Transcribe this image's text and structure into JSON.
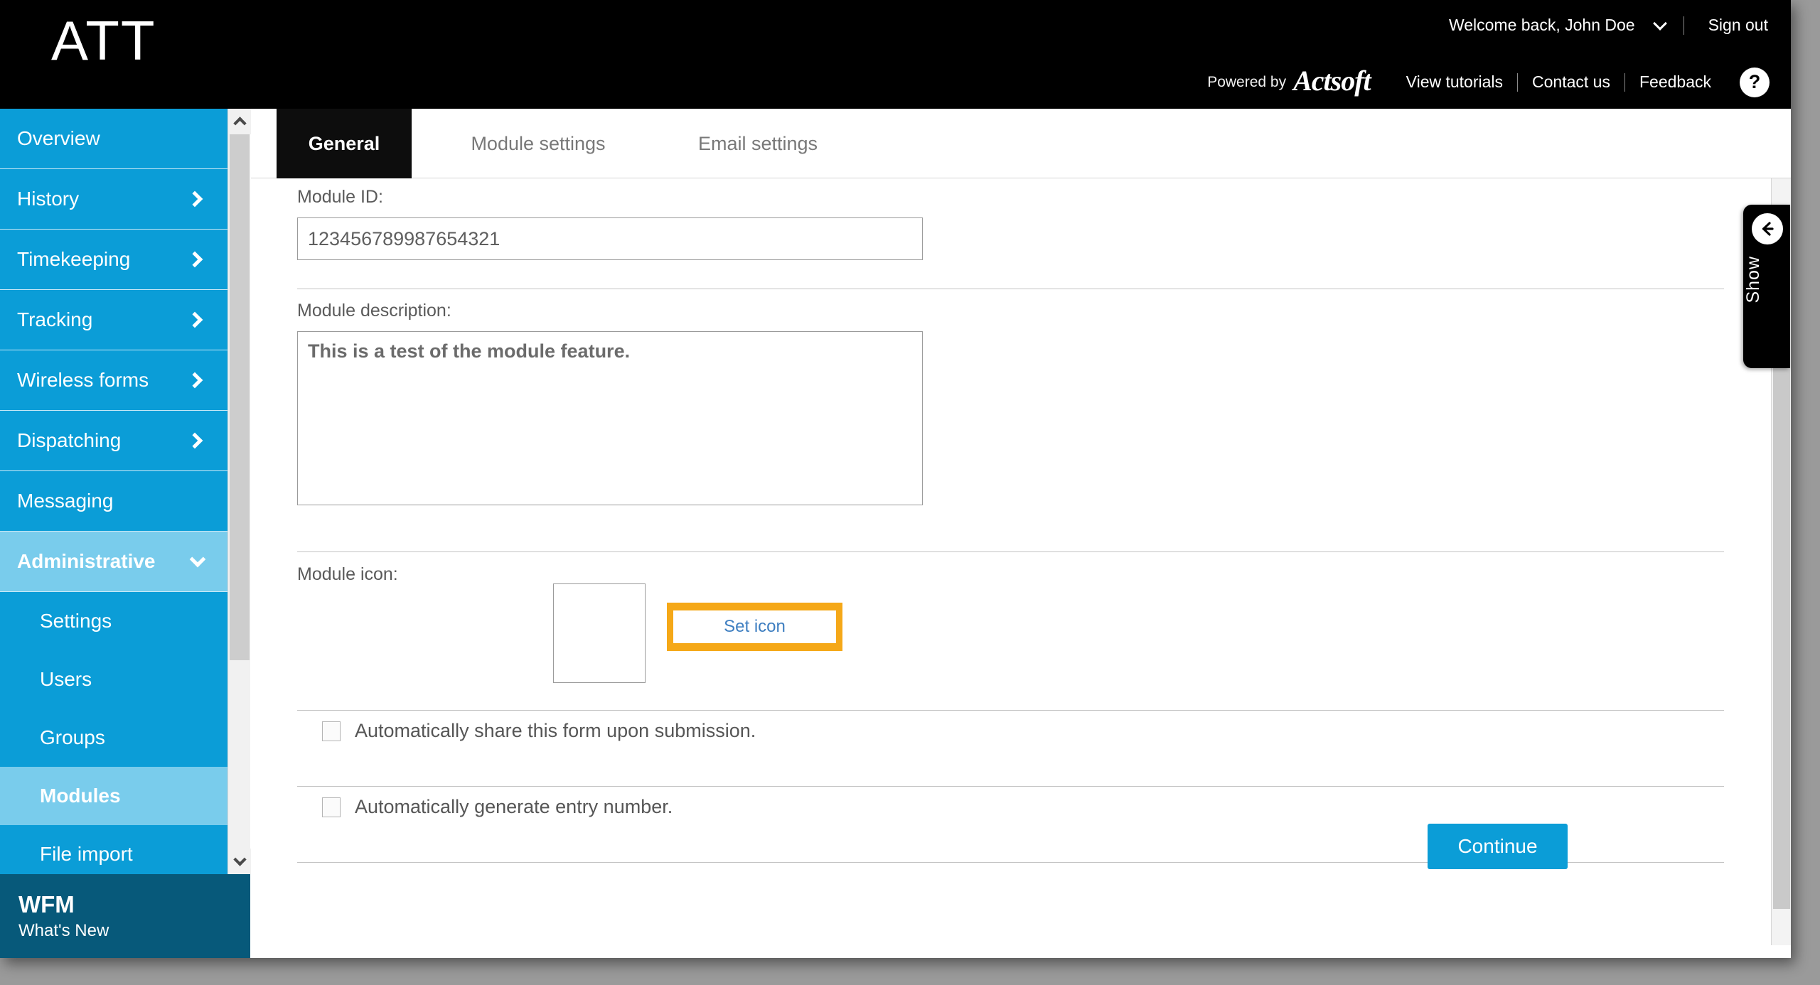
{
  "header": {
    "brand": "ATT",
    "welcome": "Welcome back, John Doe",
    "sign_out": "Sign out",
    "powered_by": "Powered by",
    "actsoft_logo": "Actsoft",
    "links": [
      {
        "label": "View tutorials"
      },
      {
        "label": "Contact us"
      },
      {
        "label": "Feedback"
      }
    ],
    "help": "?"
  },
  "sidebar": {
    "items": [
      {
        "label": "Overview",
        "arrow": "none",
        "active": false
      },
      {
        "label": "History",
        "arrow": "right",
        "active": false
      },
      {
        "label": "Timekeeping",
        "arrow": "right",
        "active": false
      },
      {
        "label": "Tracking",
        "arrow": "right",
        "active": false
      },
      {
        "label": "Wireless forms",
        "arrow": "right",
        "active": false
      },
      {
        "label": "Dispatching",
        "arrow": "right",
        "active": false
      },
      {
        "label": "Messaging",
        "arrow": "none",
        "active": false
      },
      {
        "label": "Administrative",
        "arrow": "down",
        "active": true
      }
    ],
    "subitems": [
      {
        "label": "Settings",
        "active": false
      },
      {
        "label": "Users",
        "active": false
      },
      {
        "label": "Groups",
        "active": false
      },
      {
        "label": "Modules",
        "active": true
      },
      {
        "label": "File import",
        "active": false
      }
    ]
  },
  "wfm_panel": {
    "title": "WFM",
    "subtitle": "What's New"
  },
  "tabs": [
    {
      "label": "General",
      "active": true
    },
    {
      "label": "Module settings",
      "active": false
    },
    {
      "label": "Email settings",
      "active": false
    }
  ],
  "form": {
    "module_id_label": "Module ID:",
    "module_id_value": "123456789987654321",
    "module_id_placeholder": "",
    "module_desc_label": "Module description:",
    "module_desc_value": "This is a test of the module feature.",
    "module_desc_placeholder": "",
    "module_icon_label": "Module icon:",
    "set_icon_label": "Set icon",
    "checkbox_share_label": "Automatically share this form upon submission.",
    "checkbox_share_checked": false,
    "checkbox_entry_label": "Automatically generate entry number.",
    "checkbox_entry_checked": false,
    "continue_label": "Continue"
  },
  "drawer": {
    "label": "Show",
    "arrow": "←"
  },
  "colors": {
    "brand_blue": "#0b9dd7",
    "sidebar_active": "#79ccec",
    "wfm_panel": "#07597a",
    "highlight_orange": "#f5a818",
    "link_blue": "#3f7fc1",
    "header_black": "#000000"
  }
}
